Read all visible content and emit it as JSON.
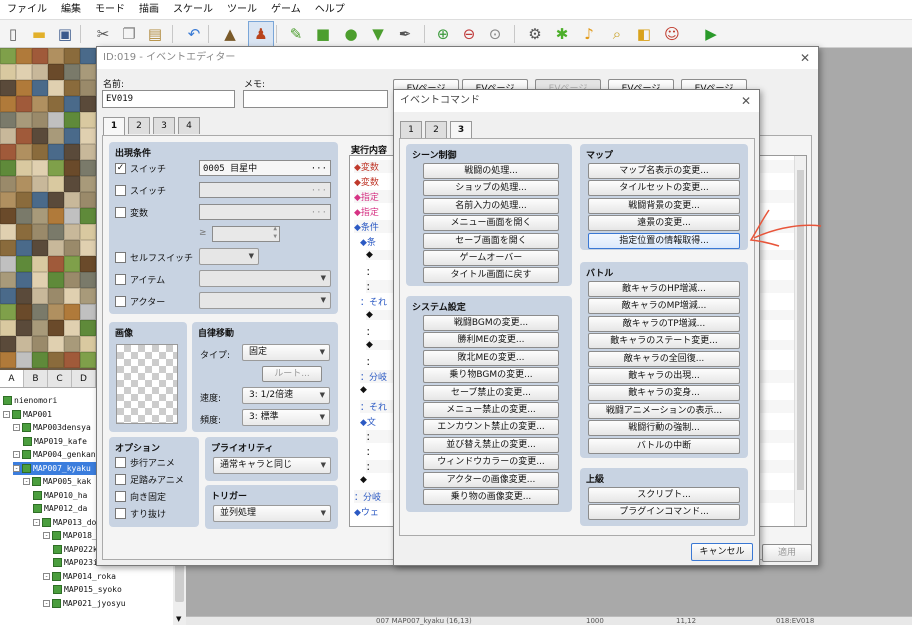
{
  "menu": [
    "ファイル",
    "編集",
    "モード",
    "描画",
    "スケール",
    "ツール",
    "ゲーム",
    "ヘルプ"
  ],
  "toolbar_icons": [
    "new-icon",
    "open-icon",
    "save-icon",
    "cut-icon",
    "copy-icon",
    "paste-icon",
    "undo-icon",
    "map-mode-icon",
    "event-mode-icon",
    "pencil-icon",
    "rectangle-icon",
    "ellipse-icon",
    "fill-icon",
    "shadow-pen-icon",
    "zoom-in-icon",
    "zoom-out-icon",
    "zoom-actual-icon",
    "database-icon",
    "plugin-icon",
    "sound-icon",
    "event-search-icon",
    "resource-icon",
    "character-generator-icon",
    "playtest-icon"
  ],
  "tile_tabs": [
    "A",
    "B",
    "C",
    "D"
  ],
  "map_tree": [
    {
      "label": "nienomori",
      "depth": 0,
      "expander": "",
      "selected": false
    },
    {
      "label": "MAP001",
      "depth": 0,
      "expander": "-",
      "selected": false
    },
    {
      "label": "MAP003densya",
      "depth": 1,
      "expander": "-",
      "selected": false
    },
    {
      "label": "MAP019_kafe",
      "depth": 2,
      "expander": "",
      "selected": false
    },
    {
      "label": "MAP004_genkan",
      "depth": 1,
      "expander": "-",
      "selected": false
    },
    {
      "label": "MAP007_kyaku",
      "depth": 1,
      "expander": "-",
      "selected": true
    },
    {
      "label": "MAP005_kak",
      "depth": 2,
      "expander": "-",
      "selected": false
    },
    {
      "label": "MAP010_ha",
      "depth": 3,
      "expander": "",
      "selected": false
    },
    {
      "label": "MAP012_da",
      "depth": 3,
      "expander": "",
      "selected": false
    },
    {
      "label": "MAP013_do",
      "depth": 3,
      "expander": "-",
      "selected": false
    },
    {
      "label": "MAP018_r",
      "depth": 4,
      "expander": "-",
      "selected": false
    },
    {
      "label": "MAP022k",
      "depth": 5,
      "expander": "",
      "selected": false
    },
    {
      "label": "MAP023ido",
      "depth": 5,
      "expander": "",
      "selected": false
    },
    {
      "label": "MAP014_roka",
      "depth": 4,
      "expander": "-",
      "selected": false
    },
    {
      "label": "MAP015_syoko",
      "depth": 5,
      "expander": "",
      "selected": false
    },
    {
      "label": "MAP021_jyosyu",
      "depth": 4,
      "expander": "-",
      "selected": false
    }
  ],
  "status_bar": [
    "007 MAP007_kyaku (16,13)",
    "1000",
    "11,12",
    "018:EV018"
  ],
  "event_editor": {
    "title": "ID:019 - イベントエディター",
    "name_label": "名前:",
    "name_value": "EV019",
    "memo_label": "メモ:",
    "memo_value": "",
    "page_buttons": [
      "EVページ",
      "EVページ",
      "EVページ",
      "EVページ",
      "EVページ"
    ],
    "tabs": [
      "1",
      "2",
      "3",
      "4"
    ],
    "conditions": {
      "title": "出現条件",
      "switch1": {
        "label": "スイッチ",
        "checked": true,
        "value": "0005 目星中"
      },
      "switch2": {
        "label": "スイッチ",
        "checked": false,
        "value": ""
      },
      "variable": {
        "label": "変数",
        "checked": false,
        "value": ""
      },
      "ge": "≥",
      "self_switch": {
        "label": "セルフスイッチ",
        "checked": false
      },
      "item": {
        "label": "アイテム",
        "checked": false
      },
      "actor": {
        "label": "アクター",
        "checked": false
      }
    },
    "image_title": "画像",
    "autonomous": {
      "title": "自律移動",
      "type_label": "タイプ:",
      "type_value": "固定",
      "route_button": "ルート...",
      "speed_label": "速度:",
      "speed_value": "3: 1/2倍速",
      "freq_label": "頻度:",
      "freq_value": "3: 標準"
    },
    "options": {
      "title": "オプション",
      "items": [
        "歩行アニメ",
        "足踏みアニメ",
        "向き固定",
        "すり抜け"
      ],
      "checked": [
        false,
        false,
        false,
        false
      ]
    },
    "priority": {
      "title": "プライオリティ",
      "value": "通常キャラと同じ"
    },
    "trigger": {
      "title": "トリガー",
      "value": "並列処理"
    },
    "contents_title": "実行内容",
    "contents_lines": [
      "◆変数",
      "◆変数",
      "◆指定",
      "◆指定",
      "◆条件",
      "◆条",
      "◆",
      "：",
      "：",
      "：それ",
      "◆",
      "：",
      "◆",
      "：",
      "：分岐",
      "◆",
      "：それ",
      "◆文",
      "：",
      "：",
      "：",
      "◆",
      "：分岐",
      "◆ウェ"
    ],
    "apply_button": "適用"
  },
  "command_dialog": {
    "title": "イベントコマンド",
    "tabs": [
      "1",
      "2",
      "3"
    ],
    "scene": {
      "title": "シーン制御",
      "buttons": [
        "戦闘の処理...",
        "ショップの処理...",
        "名前入力の処理...",
        "メニュー画面を開く",
        "セーブ画面を開く",
        "ゲームオーバー",
        "タイトル画面に戻す"
      ]
    },
    "system": {
      "title": "システム設定",
      "buttons": [
        "戦闘BGMの変更...",
        "勝利MEの変更...",
        "敗北MEの変更...",
        "乗り物BGMの変更...",
        "セーブ禁止の変更...",
        "メニュー禁止の変更...",
        "エンカウント禁止の変更...",
        "並び替え禁止の変更...",
        "ウィンドウカラーの変更...",
        "アクターの画像変更...",
        "乗り物の画像変更..."
      ]
    },
    "map": {
      "title": "マップ",
      "buttons": [
        "マップ名表示の変更...",
        "タイルセットの変更...",
        "戦闘背景の変更...",
        "遠景の変更...",
        "指定位置の情報取得..."
      ],
      "highlighted": 4
    },
    "battle": {
      "title": "バトル",
      "buttons": [
        "敵キャラのHP増減...",
        "敵キャラのMP増減...",
        "敵キャラのTP増減...",
        "敵キャラのステート変更...",
        "敵キャラの全回復...",
        "敵キャラの出現...",
        "敵キャラの変身...",
        "戦闘アニメーションの表示...",
        "戦闘行動の強制...",
        "バトルの中断"
      ]
    },
    "advanced": {
      "title": "上級",
      "buttons": [
        "スクリプト...",
        "プラグインコマンド..."
      ]
    },
    "cancel_button": "キャンセル"
  },
  "colors": {
    "group_bg": "#c8d3e2",
    "annotation_arrow": "#e8553a",
    "selection": "#3b7ddd"
  }
}
